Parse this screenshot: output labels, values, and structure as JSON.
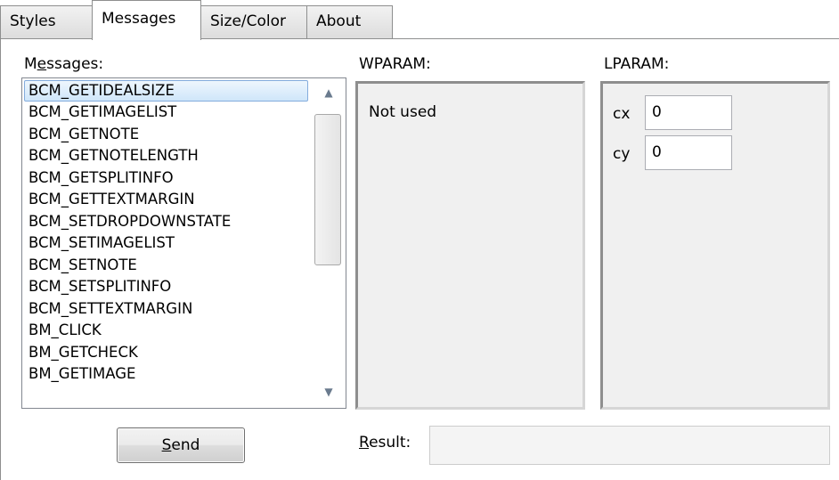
{
  "tabs": [
    {
      "label": "Styles",
      "active": false
    },
    {
      "label": "Messages",
      "active": true
    },
    {
      "label": "Size/Color",
      "active": false
    },
    {
      "label": "About",
      "active": false
    }
  ],
  "messages_label": {
    "pre": "M",
    "underlined": "e",
    "post": "ssages:"
  },
  "messages": [
    "BCM_GETIDEALSIZE",
    "BCM_GETIMAGELIST",
    "BCM_GETNOTE",
    "BCM_GETNOTELENGTH",
    "BCM_GETSPLITINFO",
    "BCM_GETTEXTMARGIN",
    "BCM_SETDROPDOWNSTATE",
    "BCM_SETIMAGELIST",
    "BCM_SETNOTE",
    "BCM_SETSPLITINFO",
    "BCM_SETTEXTMARGIN",
    "BM_CLICK",
    "BM_GETCHECK",
    "BM_GETIMAGE"
  ],
  "selected_message": "BCM_GETIDEALSIZE",
  "scroll_up_icon": "arrow-up-icon",
  "scroll_down_icon": "arrow-down-icon",
  "wparam": {
    "label": "WPARAM:",
    "text": "Not used"
  },
  "lparam": {
    "label": "LPARAM:",
    "cx_label": "cx",
    "cx_value": "0",
    "cy_label": "cy",
    "cy_value": "0"
  },
  "send_button": {
    "underlined": "S",
    "rest": "end"
  },
  "result": {
    "underlined": "R",
    "rest": "esult:",
    "value": ""
  }
}
